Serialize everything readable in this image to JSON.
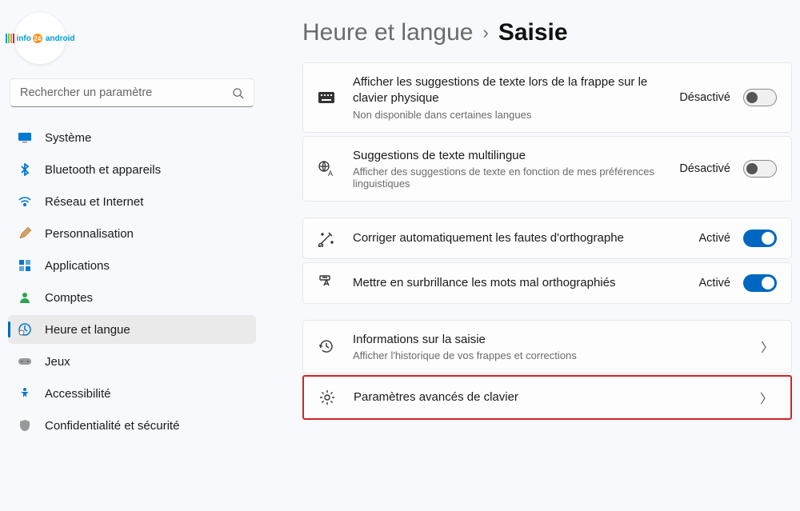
{
  "search": {
    "placeholder": "Rechercher un paramètre"
  },
  "nav": [
    {
      "label": "Système"
    },
    {
      "label": "Bluetooth et appareils"
    },
    {
      "label": "Réseau et Internet"
    },
    {
      "label": "Personnalisation"
    },
    {
      "label": "Applications"
    },
    {
      "label": "Comptes"
    },
    {
      "label": "Heure et langue"
    },
    {
      "label": "Jeux"
    },
    {
      "label": "Accessibilité"
    },
    {
      "label": "Confidentialité et sécurité"
    }
  ],
  "breadcrumb": {
    "parent": "Heure et langue",
    "sep": "›",
    "current": "Saisie"
  },
  "cards": [
    {
      "title": "Afficher les suggestions de texte lors de la frappe sur le clavier physique",
      "sub": "Non disponible dans certaines langues",
      "status": "Désactivé",
      "toggle": "off"
    },
    {
      "title": "Suggestions de texte multilingue",
      "sub": "Afficher des suggestions de texte en fonction de mes préférences linguistiques",
      "status": "Désactivé",
      "toggle": "off"
    },
    {
      "title": "Corriger automatiquement les fautes d'orthographe",
      "sub": "",
      "status": "Activé",
      "toggle": "on"
    },
    {
      "title": "Mettre en surbrillance les mots mal orthographiés",
      "sub": "",
      "status": "Activé",
      "toggle": "on"
    },
    {
      "title": "Informations sur la saisie",
      "sub": "Afficher l'historique de vos frappes et corrections"
    },
    {
      "title": "Paramètres avancés de clavier",
      "sub": ""
    }
  ]
}
